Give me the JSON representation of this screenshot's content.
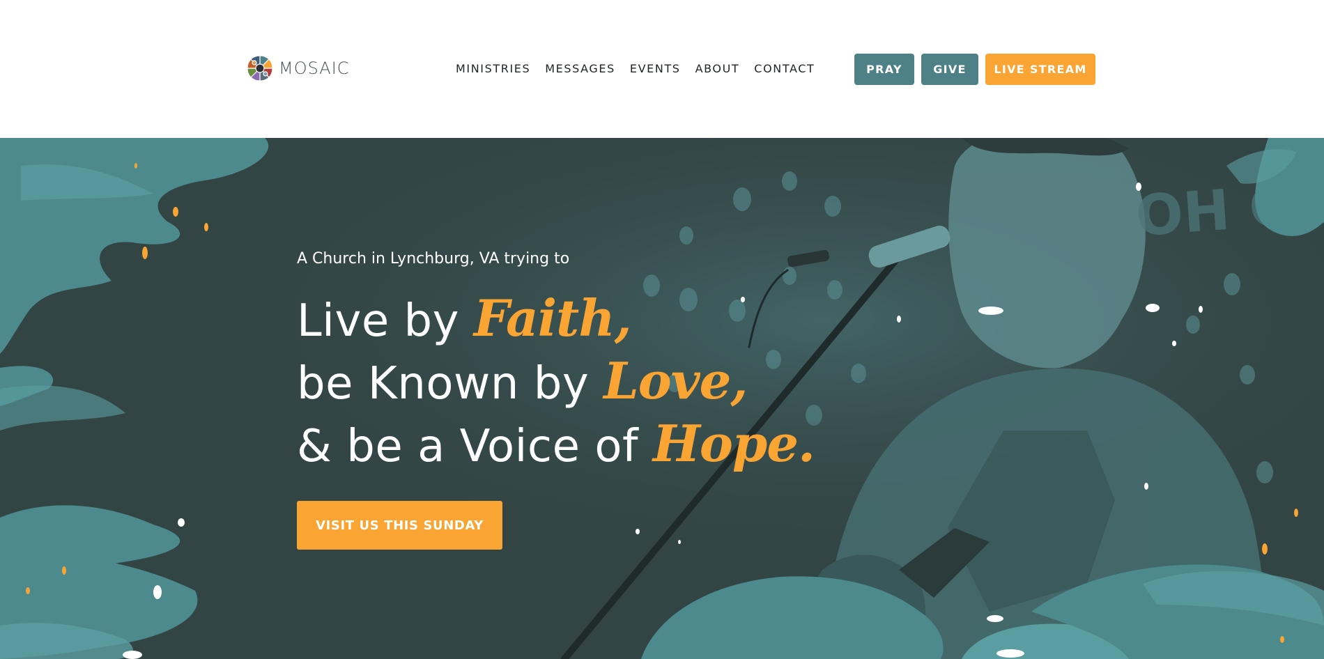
{
  "header": {
    "logo_text": "MOSAIC",
    "nav": [
      {
        "label": "MINISTRIES"
      },
      {
        "label": "MESSAGES"
      },
      {
        "label": "EVENTS"
      },
      {
        "label": "ABOUT"
      },
      {
        "label": "CONTACT"
      }
    ],
    "buttons": {
      "pray": "PRAY",
      "give": "GIVE",
      "live_stream": "LIVE STREAM"
    }
  },
  "hero": {
    "tagline": "A Church in Lynchburg, VA trying to",
    "lines": [
      {
        "text": "Live by ",
        "accent": "Faith,"
      },
      {
        "text": "be Known by ",
        "accent": "Love,"
      },
      {
        "text": "& be a Voice of ",
        "accent": "Hope."
      }
    ],
    "cta_label": "VISIT US THIS SUNDAY",
    "banner_text": "OH GOD YO"
  },
  "colors": {
    "brand_teal": "#4e8087",
    "accent_orange": "#f9a433",
    "hero_dark": "#334444",
    "hero_teal": "#4c8a8d",
    "nav_text": "#1f2326"
  },
  "icons": {
    "logo": "mosaic-logo-icon"
  }
}
